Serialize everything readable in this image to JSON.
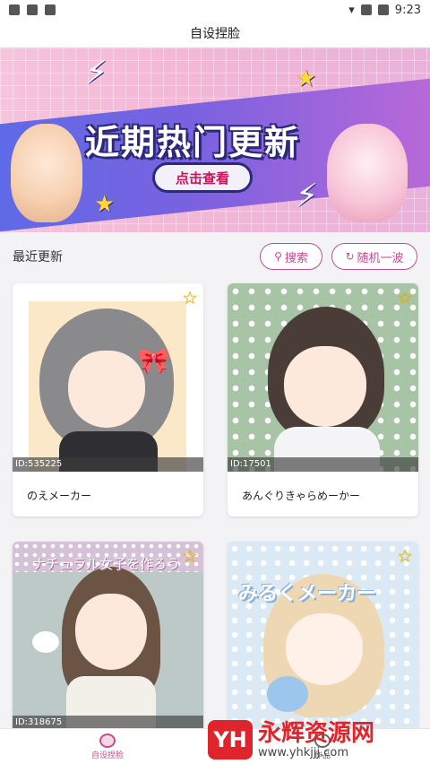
{
  "status_bar": {
    "time": "9:23"
  },
  "header": {
    "title": "自设捏脸"
  },
  "banner": {
    "headline": "近期热门更新",
    "cta": "点击查看"
  },
  "section": {
    "title": "最近更新",
    "search_label": "搜索",
    "random_label": "随机一波"
  },
  "cards": [
    {
      "id": "ID:535225",
      "name": "のえメーカー"
    },
    {
      "id": "ID:17501",
      "name": "あんぐりきゃらめーかー"
    },
    {
      "id": "ID:318675",
      "name": "",
      "art_text": "ナチュラル女子を作ろう"
    },
    {
      "id": "",
      "name": "",
      "art_text": "みるくメーカー"
    }
  ],
  "bottom_nav": {
    "items": [
      {
        "label": "自设捏脸"
      },
      {
        "label": "作品"
      }
    ]
  },
  "watermark": {
    "name": "永辉资源网",
    "url": "www.yhkjjj.com"
  },
  "colors": {
    "accent": "#c14d8c",
    "banner_band": "#6a66e4",
    "star": "#f0c400"
  },
  "icons": {
    "favorite": "star-icon",
    "search": "search-icon",
    "random": "refresh-icon"
  }
}
